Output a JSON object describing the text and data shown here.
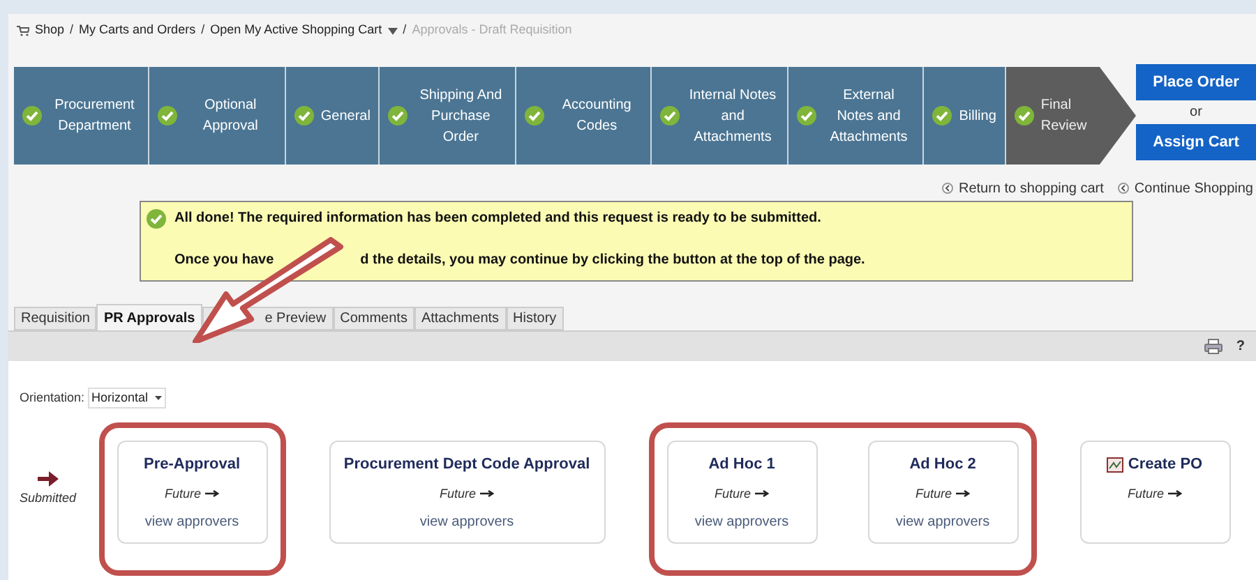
{
  "breadcrumb": [
    {
      "label": "Shop",
      "kind": "link",
      "has_menu": false
    },
    {
      "separator": "/",
      "label": "My Carts and Orders",
      "kind": "link",
      "has_menu": false
    },
    {
      "separator": "/",
      "label": "Open My Active Shopping Cart",
      "kind": "link",
      "has_menu": true
    },
    {
      "separator": "/",
      "label": "Approvals - Draft Requisition",
      "kind": "current",
      "has_menu": false
    }
  ],
  "steps": [
    {
      "label": "Procurement Department",
      "completed": true,
      "current": false
    },
    {
      "label": "Optional Approval",
      "completed": true,
      "current": false
    },
    {
      "label": "General",
      "completed": true,
      "current": false
    },
    {
      "label": "Shipping And Purchase Order",
      "completed": true,
      "current": false
    },
    {
      "label": "Accounting Codes",
      "completed": true,
      "current": false
    },
    {
      "label": "Internal Notes and Attachments",
      "completed": true,
      "current": false
    },
    {
      "label": "External Notes and Attachments",
      "completed": true,
      "current": false
    },
    {
      "label": "Billing",
      "completed": true,
      "current": false
    },
    {
      "label": "Final Review",
      "completed": true,
      "current": true
    }
  ],
  "actions": {
    "primary": "Place Order",
    "separator": "or",
    "secondary": "Assign Cart"
  },
  "links": [
    "Return to shopping cart",
    "Continue Shopping"
  ],
  "message": {
    "title": "All done! The required information has been completed and this request is ready to be submitted.",
    "line_start": "Once you have",
    "line_end": "d the details, you may continue by clicking the button at the top of the page."
  },
  "tabs": [
    {
      "label": "Requisition",
      "selected": false
    },
    {
      "label": "PR Approvals",
      "selected": true
    },
    {
      "label": "e Preview",
      "selected": false
    },
    {
      "label": "Comments",
      "selected": false
    },
    {
      "label": "Attachments",
      "selected": false
    },
    {
      "label": "History",
      "selected": false
    }
  ],
  "toolbar": {
    "help": "?"
  },
  "orientation": {
    "label": "Orientation:",
    "value": "Horizontal"
  },
  "flow": {
    "start": "Submitted",
    "stages": [
      {
        "highlighted": true,
        "steps": [
          {
            "kind": "approval",
            "title": "Pre-Approval",
            "status": "Future",
            "link": "view approvers"
          }
        ]
      },
      {
        "highlighted": false,
        "steps": [
          {
            "kind": "approval",
            "title": "Procurement Dept Code Approval",
            "status": "Future",
            "link": "view approvers"
          }
        ]
      },
      {
        "highlighted": true,
        "steps": [
          {
            "kind": "approval",
            "title": "Ad Hoc 1",
            "status": "Future",
            "link": "view approvers"
          },
          {
            "kind": "approval",
            "title": "Ad Hoc 2",
            "status": "Future",
            "link": "view approvers"
          }
        ]
      },
      {
        "highlighted": false,
        "steps": [
          {
            "kind": "action",
            "title": "Create PO",
            "status": "Future"
          }
        ]
      }
    ]
  }
}
